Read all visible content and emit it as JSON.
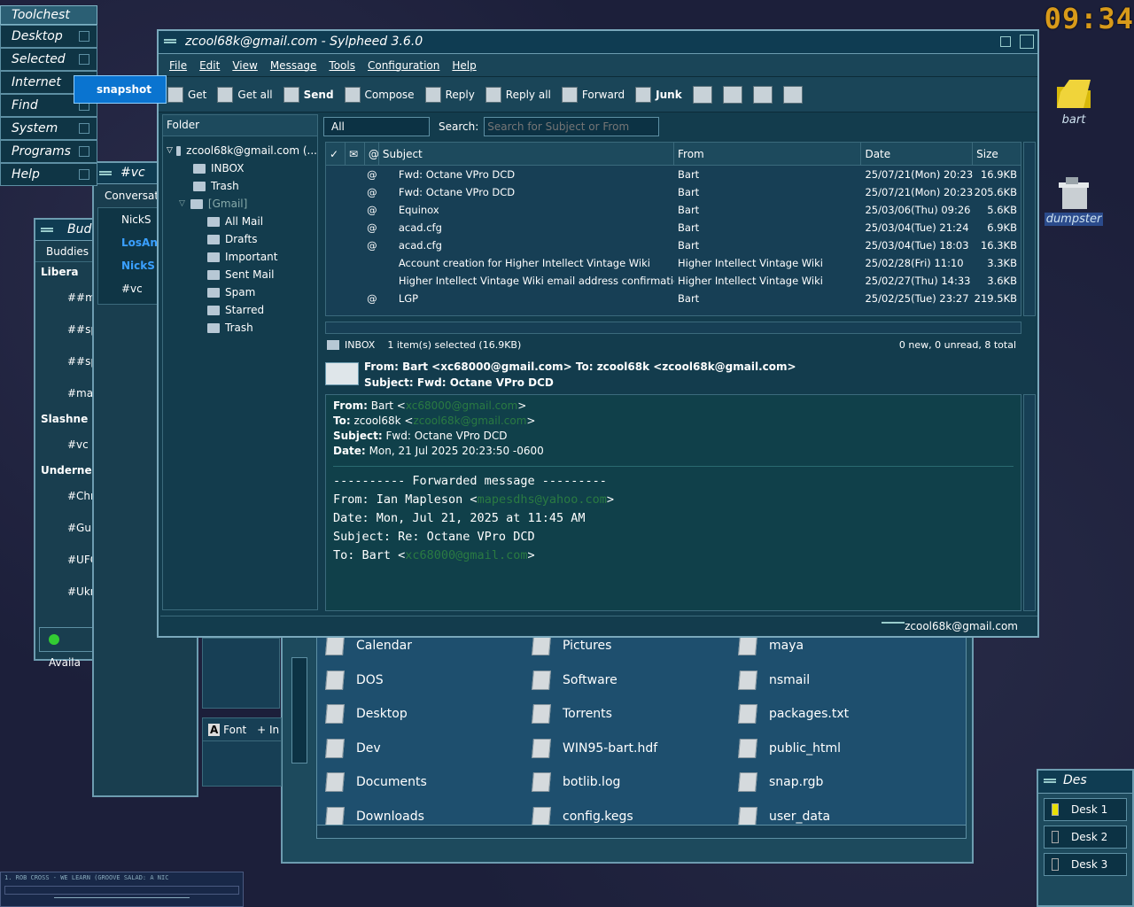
{
  "clock": "09:34",
  "toolchest": {
    "title": "Toolchest",
    "items": [
      "Desktop",
      "Selected",
      "Internet",
      "Find",
      "System",
      "Programs",
      "Help"
    ],
    "popup": "snapshot"
  },
  "desktop_icons": [
    {
      "label": "bart"
    },
    {
      "label": "dumpster"
    }
  ],
  "irc": {
    "title": "#vc",
    "tab": "Conversati",
    "users": [
      "NickS",
      "LosAng",
      "NickS",
      "#vc"
    ],
    "font_btn": "Font",
    "insert_btn": "+ In"
  },
  "buddy": {
    "title": "Bud",
    "tab": "Buddies",
    "groups": [
      {
        "name": "Libera",
        "rooms": [
          "##ma",
          "##spa",
          "##spa",
          "#mac"
        ]
      },
      {
        "name": "Slashne",
        "rooms": [
          "#vc"
        ]
      },
      {
        "name": "Underne",
        "rooms": [
          "#Chri",
          "#Gula",
          "#UFC",
          "#Ukra"
        ]
      }
    ],
    "status": "Availa"
  },
  "sylpheed": {
    "title": "zcool68k@gmail.com - Sylpheed 3.6.0",
    "menu": [
      "File",
      "Edit",
      "View",
      "Message",
      "Tools",
      "Configuration",
      "Help"
    ],
    "toolbar": [
      "Get",
      "Get all",
      "Send",
      "Compose",
      "Reply",
      "Reply all",
      "Forward",
      "Junk"
    ],
    "folder_header": "Folder",
    "account": "zcool68k@gmail.com (...",
    "folders": [
      "INBOX",
      "Trash",
      "[Gmail]",
      "All Mail",
      "Drafts",
      "Important",
      "Sent Mail",
      "Spam",
      "Starred",
      "Trash"
    ],
    "filter": "All",
    "search_label": "Search:",
    "search_placeholder": "Search for Subject or From",
    "columns": [
      "Subject",
      "From",
      "Date",
      "Size"
    ],
    "messages": [
      {
        "attach": true,
        "subject": "Fwd: Octane VPro DCD",
        "from": "Bart",
        "date": "25/07/21(Mon) 20:23",
        "size": "16.9KB"
      },
      {
        "attach": true,
        "subject": "Fwd: Octane VPro DCD",
        "from": "Bart",
        "date": "25/07/21(Mon) 20:23",
        "size": "205.6KB"
      },
      {
        "attach": true,
        "subject": "Equinox",
        "from": "Bart",
        "date": "25/03/06(Thu) 09:26",
        "size": "5.6KB"
      },
      {
        "attach": true,
        "subject": "acad.cfg",
        "from": "Bart",
        "date": "25/03/04(Tue) 21:24",
        "size": "6.9KB"
      },
      {
        "attach": true,
        "subject": "acad.cfg",
        "from": "Bart",
        "date": "25/03/04(Tue) 18:03",
        "size": "16.3KB"
      },
      {
        "attach": false,
        "subject": "Account creation for Higher Intellect Vintage Wiki",
        "from": "Higher Intellect Vintage Wiki",
        "date": "25/02/28(Fri) 11:10",
        "size": "3.3KB"
      },
      {
        "attach": false,
        "subject": "Higher Intellect Vintage Wiki email address confirmation",
        "from": "Higher Intellect Vintage Wiki",
        "date": "25/02/27(Thu) 14:33",
        "size": "3.6KB"
      },
      {
        "attach": true,
        "subject": "LGP",
        "from": "Bart",
        "date": "25/02/25(Tue) 23:27",
        "size": "219.5KB"
      }
    ],
    "status_folder": "INBOX",
    "status_sel": "1 item(s) selected (16.9KB)",
    "status_counts": "0 new, 0 unread, 8 total",
    "summary_from": "From: Bart <xc68000@gmail.com>  To: zcool68k <zcool68k@gmail.com>",
    "summary_subject": "Subject: Fwd: Octane VPro DCD",
    "hdr_from_label": "From:",
    "hdr_from_name": "Bart <",
    "hdr_from_mail": "xc68000@gmail.com",
    "hdr_to_label": "To:",
    "hdr_to_name": "zcool68k <",
    "hdr_to_mail": "zcool68k@gmail.com",
    "hdr_subject": "Fwd: Octane VPro DCD",
    "hdr_date": "Mon, 21 Jul 2025 20:23:50 -0600",
    "body": [
      "---------- Forwarded message ---------",
      "From: Ian Mapleson <",
      "Date: Mon, Jul 21, 2025 at 11:45 AM",
      "Subject: Re: Octane VPro DCD",
      "To: Bart <"
    ],
    "body_mail1": "mapesdhs@yahoo.com",
    "body_mail2": "xc68000@gmail.com",
    "bottom_account": "zcool68k@gmail.com"
  },
  "filemgr": {
    "cols": [
      [
        "Calendar",
        "DOS",
        "Desktop",
        "Dev",
        "Documents",
        "Downloads"
      ],
      [
        "Pictures",
        "Software",
        "Torrents",
        "WIN95-bart.hdf",
        "botlib.log",
        "config.kegs"
      ],
      [
        "maya",
        "nsmail",
        "packages.txt",
        "public_html",
        "snap.rgb",
        "user_data"
      ]
    ]
  },
  "desks": {
    "title": "Des",
    "items": [
      "Desk 1",
      "Desk 2",
      "Desk 3"
    ]
  },
  "player": {
    "ticker": "1. ROB CROSS - WE LEARN (GROOVE SALAD: A NIC"
  }
}
